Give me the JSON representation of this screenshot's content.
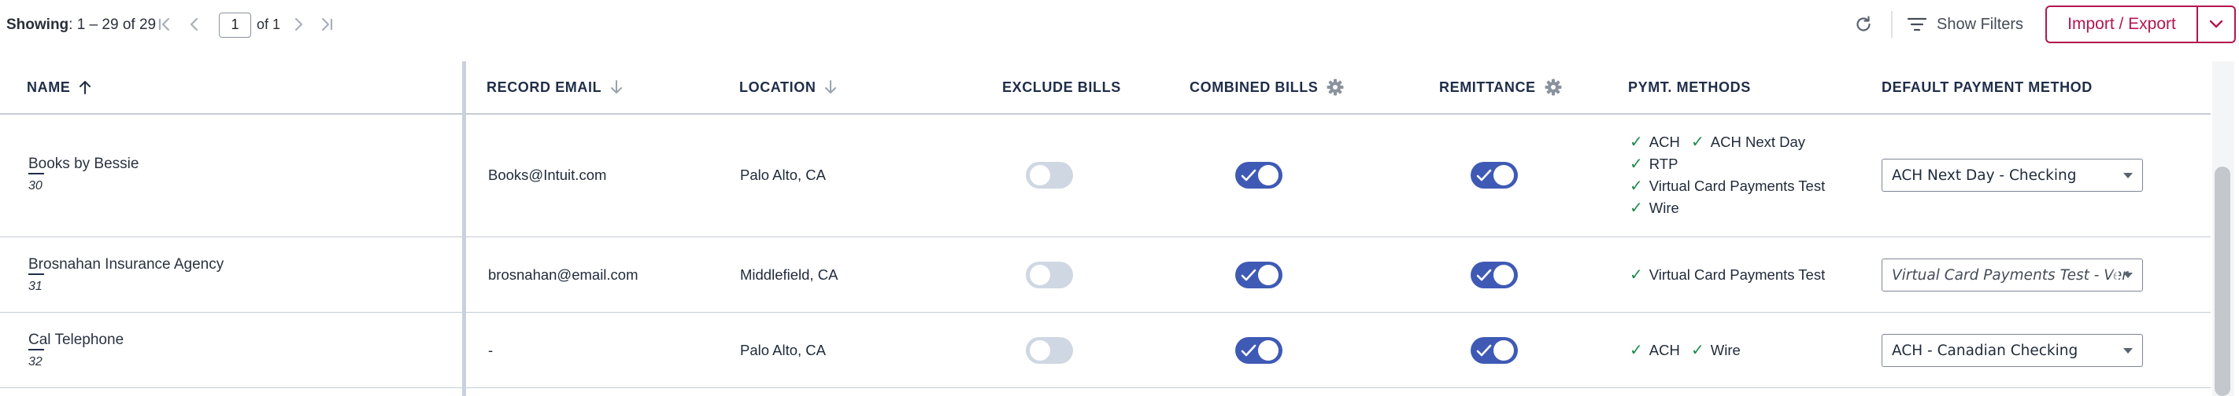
{
  "toolbar": {
    "showing_label": "Showing",
    "showing_range": ": 1 – 29 of 29",
    "page_current": "1",
    "page_of": "of 1",
    "refresh_icon": "refresh-icon",
    "show_filters_label": "Show Filters",
    "import_export_label": "Import / Export"
  },
  "columns": {
    "name": "NAME",
    "record_email": "RECORD EMAIL",
    "location": "LOCATION",
    "exclude_bills": "EXCLUDE BILLS",
    "combined_bills": "COMBINED BILLS",
    "remittance": "REMITTANCE",
    "pymt_methods": "PYMT. METHODS",
    "default_payment_method": "DEFAULT PAYMENT METHOD"
  },
  "rows": [
    {
      "name": "Books by Bessie",
      "id": "30",
      "email": "Books@Intuit.com",
      "location": "Palo Alto, CA",
      "exclude_bills": false,
      "combined_bills": true,
      "remittance": true,
      "methods": [
        "ACH",
        "ACH Next Day",
        "RTP",
        "Virtual Card Payments Test",
        "Wire"
      ],
      "default_method": "ACH Next Day - Checking"
    },
    {
      "name": "Brosnahan Insurance Agency",
      "id": "31",
      "email": "brosnahan@email.com",
      "location": "Middlefield, CA",
      "exclude_bills": false,
      "combined_bills": true,
      "remittance": true,
      "methods": [
        "Virtual Card Payments Test"
      ],
      "default_method": "Virtual Card Payments Test - Ver"
    },
    {
      "name": "Cal Telephone",
      "id": "32",
      "email": "-",
      "location": "Palo Alto, CA",
      "exclude_bills": false,
      "combined_bills": true,
      "remittance": true,
      "methods": [
        "ACH",
        "Wire"
      ],
      "default_method": "ACH - Canadian Checking"
    }
  ],
  "colors": {
    "accent": "#b3164f",
    "toggle_on": "#3f5ab5",
    "toggle_off": "#cfd7e3",
    "check": "#1e8a4c",
    "header_text": "#1f2d49"
  }
}
